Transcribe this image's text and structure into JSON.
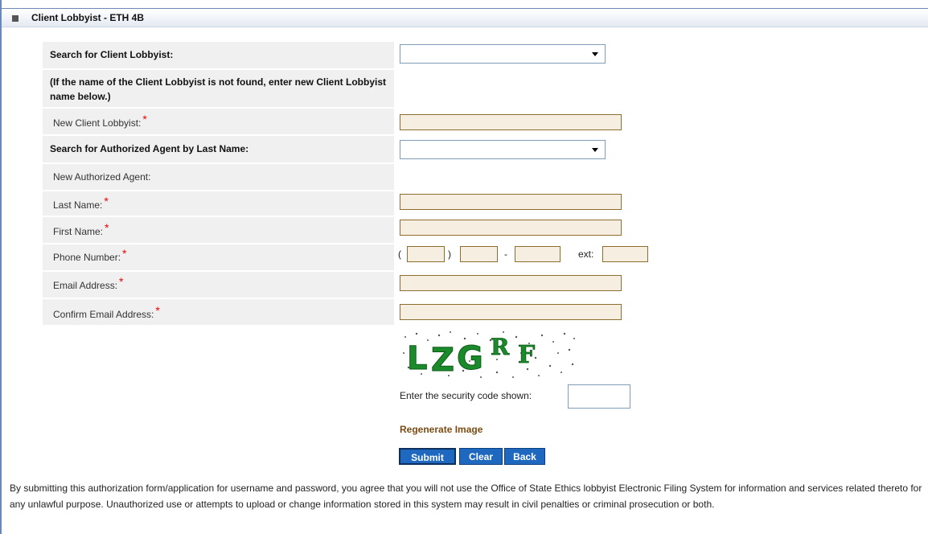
{
  "section": {
    "title": "Client Lobbyist - ETH 4B"
  },
  "form": {
    "search_client_label": "Search for Client Lobbyist:",
    "not_found_note": "(If the name of the Client Lobbyist is not found, enter new Client Lobbyist name below.)",
    "new_client_label": "New Client Lobbyist:",
    "search_agent_label": "Search for Authorized Agent by Last Name:",
    "new_agent_label": "New Authorized Agent:",
    "last_name_label": "Last Name:",
    "first_name_label": "First Name:",
    "phone_label": "Phone Number:",
    "email_label": "Email Address:",
    "confirm_email_label": "Confirm Email Address:",
    "required_mark": "*",
    "phone": {
      "open_paren": "(",
      "close_paren": ")",
      "dash": "-",
      "ext_label": "ext:"
    }
  },
  "captcha": {
    "code": "LZGRF",
    "prompt": "Enter the security code shown:",
    "regenerate_link": "Regenerate Image"
  },
  "buttons": {
    "submit": "Submit",
    "clear": "Clear",
    "back": "Back"
  },
  "footer": {
    "notice": "By submitting this authorization form/application for username and password, you agree that you will not use the Office of State Ethics lobbyist Electronic Filing System for information and services related thereto for any unlawful purpose. Unauthorized use or attempts to upload or change information stored in this system may result in civil penalties or criminal prosecution or both."
  },
  "colors": {
    "header_border": "#6a8ab5",
    "label_bg": "#f0f0f0",
    "input_bg": "#f5eee1",
    "input_border": "#8d6e2e",
    "required": "#e00000",
    "button_bg": "#1e68c0",
    "link": "#7a4b12",
    "captcha_green": "#1b8a2a"
  }
}
